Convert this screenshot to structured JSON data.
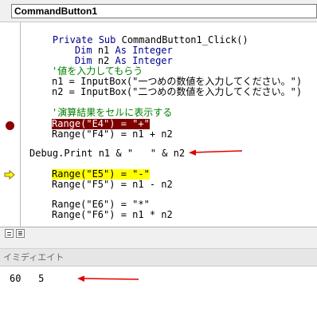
{
  "procedure_combo": {
    "value": "CommandButton1"
  },
  "code": {
    "l1_kw_a": "Private Sub ",
    "l1_rest": "CommandButton1_Click()",
    "l2_kw": "Dim",
    "l2_mid": " n1 ",
    "l2_kw2": "As Integer",
    "l3_kw": "Dim",
    "l3_mid": " n2 ",
    "l3_kw2": "As Integer",
    "l4_comment": "'値を入力してもらう",
    "l5": "n1 = InputBox(\"一つめの数値を入力してください。\")",
    "l6": "n2 = InputBox(\"二つめの数値を入力してください。\")",
    "l7_comment": "'演算結果をセルに表示する",
    "l8_breakpoint": "Range(\"E4\") = \"+\"",
    "l9": "Range(\"F4\") = n1 + n2",
    "l10": "Debug.Print n1 & \"   \" & n2",
    "l11_exec": "Range(\"E5\") = \"-\"",
    "l12": "Range(\"F5\") = n1 - n2",
    "l13": "Range(\"E6\") = \"*\"",
    "l14": "Range(\"F6\") = n1 * n2"
  },
  "immediate": {
    "title": "イミディエイト",
    "output": "60   5"
  },
  "colors": {
    "breakpoint": "#7f0000",
    "execution_line": "#ffff00",
    "annotation_arrow": "#e00000",
    "keyword": "#00008b",
    "comment": "#008000"
  },
  "icons": [
    "breakpoint-dot-icon",
    "execution-arrow-icon",
    "procedure-view-icon",
    "full-module-view-icon"
  ]
}
